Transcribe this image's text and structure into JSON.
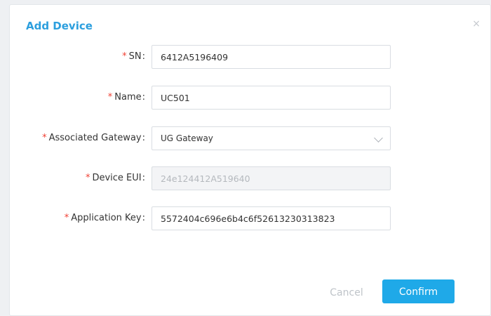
{
  "dialog": {
    "title": "Add Device",
    "close_glyph": "×"
  },
  "form": {
    "required_mark": "*",
    "colon": ":",
    "sn": {
      "label": "SN",
      "value": "6412A5196409"
    },
    "name": {
      "label": "Name",
      "value": "UC501"
    },
    "gateway": {
      "label": "Associated Gateway",
      "value": "UG Gateway"
    },
    "device_eui": {
      "label": "Device EUI",
      "value": "24e124412A519640"
    },
    "app_key": {
      "label": "Application Key",
      "value": "5572404c696e6b4c6f52613230313823"
    }
  },
  "footer": {
    "cancel_label": "Cancel",
    "confirm_label": "Confirm"
  },
  "colors": {
    "title": "#2c9fde",
    "required": "#f04134",
    "confirm_bg": "#1fa9e8"
  },
  "icons": {
    "close": "close-icon",
    "dropdown": "chevron-down-icon"
  }
}
